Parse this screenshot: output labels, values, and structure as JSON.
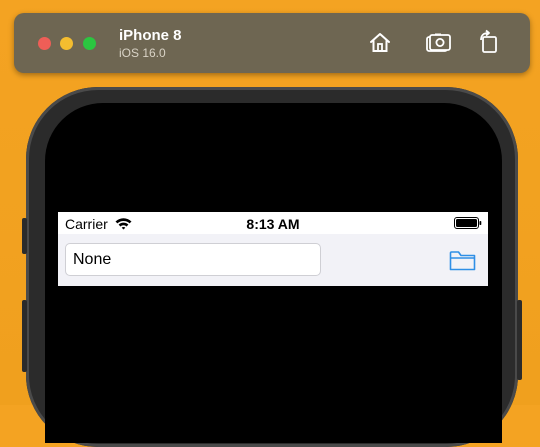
{
  "window": {
    "device_name": "iPhone 8",
    "os_version": "iOS 16.0",
    "buttons": [
      "home-icon",
      "screenshot-icon",
      "rotate-icon"
    ]
  },
  "status_bar": {
    "carrier": "Carrier",
    "time": "8:13 AM"
  },
  "app": {
    "text_field_value": "None",
    "folder_button_icon": "folder-icon"
  },
  "colors": {
    "background": "#f0a01e",
    "toolbar": "#6e6652",
    "accent": "#2f8fe6"
  }
}
